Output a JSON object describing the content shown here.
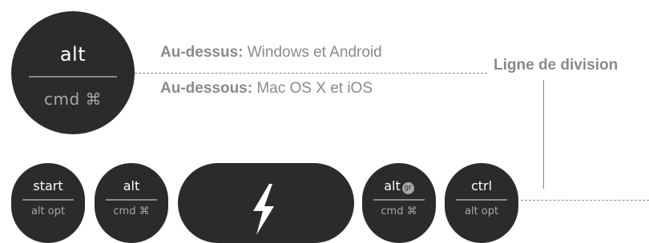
{
  "big_key": {
    "top": "alt",
    "bottom": "cmd ⌘"
  },
  "labels": {
    "above_bold": "Au-dessus:",
    "above_text": " Windows et Android",
    "below_bold": "Au-dessous:",
    "below_text": " Mac OS X et iOS",
    "division": "Ligne de division"
  },
  "keys": [
    {
      "top": "start",
      "bottom": "alt opt"
    },
    {
      "top": "alt",
      "bottom": "cmd ⌘"
    },
    {
      "top": "alt",
      "badge": "gr",
      "bottom": "cmd ⌘"
    },
    {
      "top": "ctrl",
      "bottom": "alt opt"
    }
  ],
  "colors": {
    "key": "#2b2b2d",
    "text_gray": "#8a8a8e",
    "divider": "#8a8a8e"
  }
}
